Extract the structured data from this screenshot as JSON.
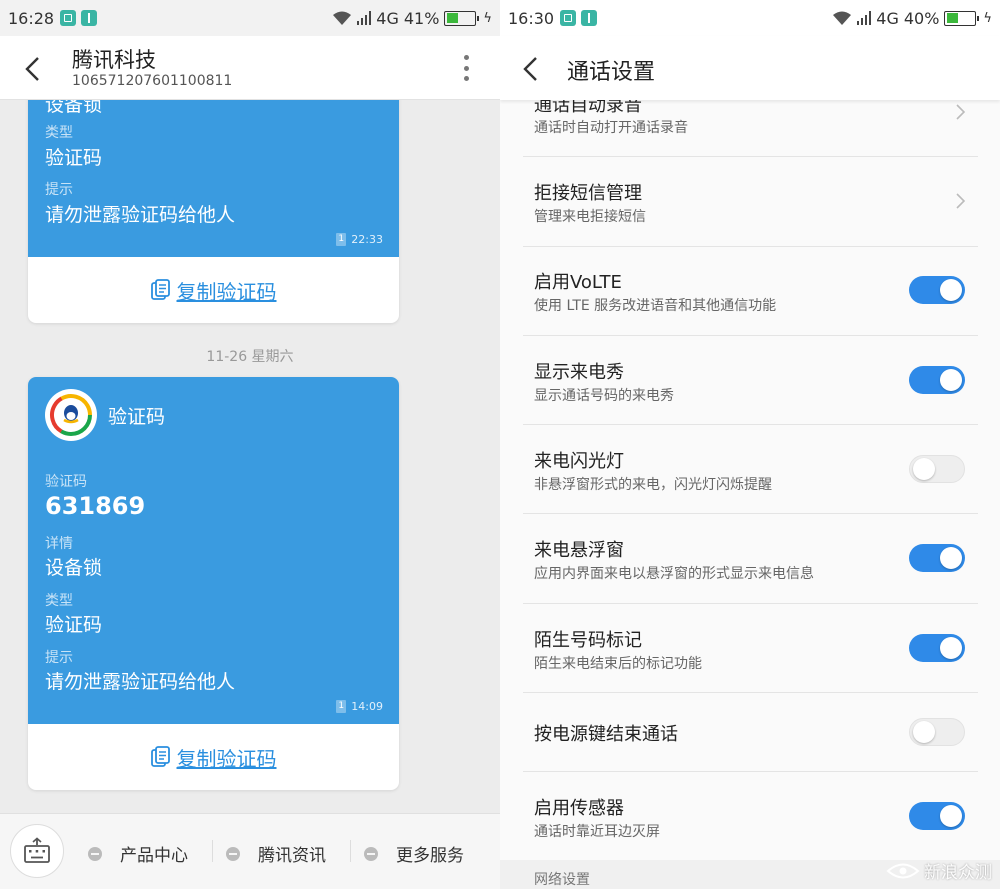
{
  "left": {
    "status": {
      "time": "16:28",
      "network": "4G",
      "battery": "41%",
      "battery_level": 0.41
    },
    "header": {
      "title": "腾讯科技",
      "subtitle": "106571207601100811"
    },
    "card1": {
      "partial_value": "设备锁",
      "type_label": "类型",
      "type_value": "验证码",
      "tip_label": "提示",
      "tip_value": "请勿泄露验证码给他人",
      "sim": "1",
      "time": "22:33",
      "copy_label": "复制验证码"
    },
    "date_separator": "11-26  星期六",
    "card2": {
      "title": "验证码",
      "code_label": "验证码",
      "code_value": "631869",
      "detail_label": "详情",
      "detail_value": "设备锁",
      "type_label": "类型",
      "type_value": "验证码",
      "tip_label": "提示",
      "tip_value": "请勿泄露验证码给他人",
      "sim": "1",
      "time": "14:09",
      "copy_label": "复制验证码"
    },
    "bottom_menu": [
      "产品中心",
      "腾讯资讯",
      "更多服务"
    ]
  },
  "right": {
    "status": {
      "time": "16:30",
      "network": "4G",
      "battery": "40%",
      "battery_level": 0.4
    },
    "header": {
      "title": "通话设置"
    },
    "settings": [
      {
        "title": "通话自动录音",
        "subtitle": "通话时自动打开通话录音",
        "control": "chevron"
      },
      {
        "title": "拒接短信管理",
        "subtitle": "管理来电拒接短信",
        "control": "chevron"
      },
      {
        "title": "启用VoLTE",
        "subtitle": "使用 LTE 服务改进语音和其他通信功能",
        "control": "toggle",
        "on": true
      },
      {
        "title": "显示来电秀",
        "subtitle": "显示通话号码的来电秀",
        "control": "toggle",
        "on": true
      },
      {
        "title": "来电闪光灯",
        "subtitle": "非悬浮窗形式的来电，闪光灯闪烁提醒",
        "control": "toggle",
        "on": false
      },
      {
        "title": "来电悬浮窗",
        "subtitle": "应用内界面来电以悬浮窗的形式显示来电信息",
        "control": "toggle",
        "on": true
      },
      {
        "title": "陌生号码标记",
        "subtitle": "陌生来电结束后的标记功能",
        "control": "toggle",
        "on": true
      },
      {
        "title": "按电源键结束通话",
        "subtitle": "",
        "control": "toggle",
        "on": false
      },
      {
        "title": "启用传感器",
        "subtitle": "通话时靠近耳边灭屏",
        "control": "toggle",
        "on": true
      }
    ],
    "section_label": "网络设置",
    "watermark": "新浪众测"
  },
  "colors": {
    "card_blue": "#3a9be0",
    "toggle_on": "#2f8ae8",
    "link_blue": "#2a8fdf"
  }
}
